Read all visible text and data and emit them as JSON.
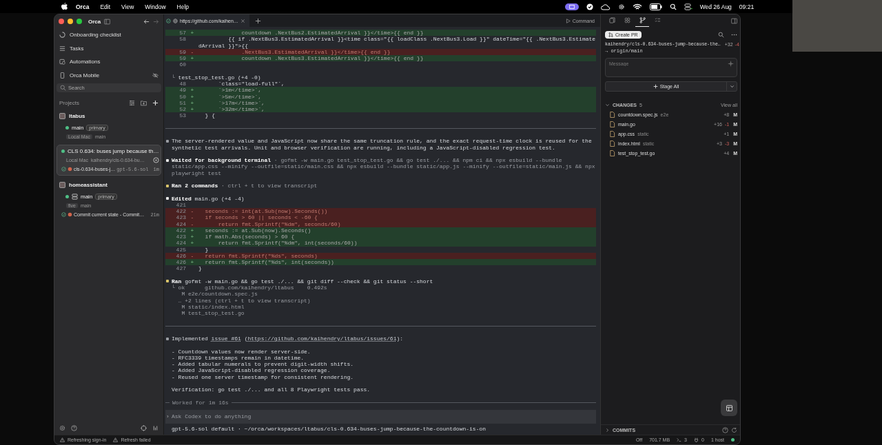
{
  "menubar": {
    "app": "Orca",
    "menus": [
      "Edit",
      "View",
      "Window",
      "Help"
    ],
    "date": "Wed 26 Aug",
    "time": "09:21"
  },
  "sidebar": {
    "title": "Orca",
    "back_disabled": false,
    "forward_disabled": true,
    "nav": [
      {
        "label": "Onboarding checklist"
      },
      {
        "label": "Tasks"
      },
      {
        "label": "Automations"
      },
      {
        "label": "Orca Mobile"
      }
    ],
    "search": {
      "placeholder": "Search"
    },
    "projects_label": "Projects",
    "projects": [
      {
        "name": "ltabus",
        "worktrees": [
          {
            "name": "main",
            "badge": "primary",
            "selected": false,
            "tags": [
              {
                "text": "Local Mac",
                "boxed": true
              },
              {
                "text": "main",
                "boxed": false
              }
            ]
          },
          {
            "name": "CLS 0.634: buses jump because th…",
            "selected": true,
            "tags": [
              {
                "text": "Local Mac",
                "boxed": false
              },
              {
                "text": "kaihendry/cls-0.634-bu…",
                "boxed": false
              }
            ],
            "session": {
              "name": "cls-0.634-buses-j…",
              "model": "gpt-5.6-sol",
              "age": "1m"
            }
          }
        ]
      },
      {
        "name": "homeassistant",
        "worktrees": [
          {
            "name": "main",
            "badge": "primary",
            "selected": false,
            "tags": [
              {
                "text": "five",
                "boxed": true
              },
              {
                "text": "main",
                "boxed": false
              }
            ],
            "session": {
              "name": "Commit current state - Commit…",
              "age": "21m"
            }
          }
        ]
      }
    ]
  },
  "tabs": [
    {
      "label": "https://github.com/kaihen…",
      "selected": true
    }
  ],
  "command_label": "Command",
  "transcript": [
    {
      "kind": "diff",
      "lines": [
        {
          "num": "57",
          "sign": "+",
          "code": "             countdown .NextBus2.EstimatedArrival }}</time>{{ end }}"
        },
        {
          "num": "58",
          "code": "         {{ if .NextBus3.EstimatedArrival }}<time class=\"{{ loadClass .NextBus3.Load }}\" dateTime=\"{{ .NextBus3.EstimatedArrival }}\">{{"
        },
        {
          "num": "59",
          "sign": "-",
          "code": "             .NextBus3.EstimatedArrival }}</time>{{ end }}"
        },
        {
          "num": "59",
          "sign": "+",
          "code": "             countdown .NextBus3.EstimatedArrival }}</time>{{ end }}"
        },
        {
          "num": "60"
        }
      ]
    },
    {
      "kind": "diff",
      "header": {
        "prefix": "└",
        "file": "test_stop_test.go",
        "stats": "(+4 -0)"
      },
      "lines": [
        {
          "num": "48",
          "code": "      `class=\"load-full\"`,"
        },
        {
          "num": "49",
          "sign": "+",
          "code": "      `>1m</time>`,"
        },
        {
          "num": "50",
          "sign": "+",
          "code": "      `>5m</time>`,"
        },
        {
          "num": "51",
          "sign": "+",
          "code": "      `>17m</time>`,"
        },
        {
          "num": "52",
          "sign": "+",
          "code": "      `>32m</time>`,"
        },
        {
          "num": "53",
          "code": "  } {"
        }
      ]
    },
    {
      "kind": "rule"
    },
    {
      "kind": "message",
      "color": "#9a9da3",
      "text": "The server-rendered value and JavaScript now share the same truncation rule, and the exact request-time clock is reused for the synthetic test arrivals. Unit and browser verification are running, including a JavaScript-disabled regression test."
    },
    {
      "kind": "message",
      "color": "#e8e8e8",
      "title": "Waited for background terminal",
      "detail": "· gofmt -w main.go test_stop_test.go && go test ./... && npm ci && npx esbuild --bundle static/app.css --minify --outfile=static/main.css && npx esbuild --bundle static/app.js --minify --outfile=static/main.js && npx playwright test"
    },
    {
      "kind": "message",
      "color": "#d9c46a",
      "title": "Ran 2 commands",
      "detail": "· ctrl + t to view transcript"
    },
    {
      "kind": "diff",
      "header": {
        "color": "#e8e8e8",
        "title": "Edited",
        "file": "main.go",
        "stats": "(+4 -4)"
      },
      "lines": [
        {
          "num": "421"
        },
        {
          "num": "422",
          "sign": "-",
          "code": "  seconds := int(at.Sub(now).Seconds())"
        },
        {
          "num": "423",
          "sign": "-",
          "code": "  if seconds > 60 || seconds < -60 {"
        },
        {
          "num": "424",
          "sign": "-",
          "code": "      return fmt.Sprintf(\"%dm\", seconds/60)"
        },
        {
          "num": "422",
          "sign": "+",
          "code": "  seconds := at.Sub(now).Seconds()"
        },
        {
          "num": "423",
          "sign": "+",
          "code": "  if math.Abs(seconds) > 60 {"
        },
        {
          "num": "424",
          "sign": "+",
          "code": "      return fmt.Sprintf(\"%dm\", int(seconds/60))"
        },
        {
          "num": "425",
          "code": "  }"
        },
        {
          "num": "426",
          "sign": "-",
          "code": "  return fmt.Sprintf(\"%ds\", seconds)"
        },
        {
          "num": "426",
          "sign": "+",
          "code": "  return fmt.Sprintf(\"%ds\", int(seconds))"
        },
        {
          "num": "427",
          "code": "}"
        }
      ]
    },
    {
      "kind": "message",
      "color": "#d9c46a",
      "title": "Ran",
      "command": "gofmt -w main.go && go test ./... && git diff --check && git status --short",
      "lines": [
        "└ ok      github.com/kaihendry/ltabus    0.492s",
        "   M e2e/countdown.spec.js",
        "  … +2 lines (ctrl + t to view transcript)",
        "   M static/index.html",
        "   M test_stop_test.go"
      ]
    },
    {
      "kind": "rule"
    },
    {
      "kind": "message",
      "color": "#9a9da3",
      "segments": [
        {
          "text": "Implemented "
        },
        {
          "text": "issue #61",
          "link": true
        },
        {
          "text": " ("
        },
        {
          "text": "https://github.com/kaihendry/ltabus/issues/61",
          "link": true
        },
        {
          "text": "):"
        }
      ]
    },
    {
      "kind": "list",
      "items": [
        [
          {
            "text": "- Countdown values now render server-side."
          }
        ],
        [
          {
            "text": "- RFC3339 timestamps remain in datetime."
          }
        ],
        [
          {
            "text": "- Added tabular numerals to prevent digit-width shifts."
          }
        ],
        [
          {
            "text": "- Added JavaScript-disabled regression coverage."
          }
        ],
        [
          {
            "text": "- Reused one server timestamp for consistent rendering."
          }
        ]
      ]
    },
    {
      "kind": "message",
      "text": "Verification: go test ./... and all 8 Playwright tests pass."
    },
    {
      "kind": "worked",
      "text": "Worked for 1m 16s"
    }
  ],
  "composer": {
    "prompt": "›",
    "placeholder": "Ask Codex to do anything"
  },
  "footer": "gpt-5.6-sol default · ~/orca/workspaces/ltabus/cls-0.634-buses-jump-because-the-countdown-is-on",
  "panel": {
    "tabs": [
      {
        "selected": false
      },
      {
        "selected": false
      },
      {
        "selected": true
      },
      {
        "selected": false
      }
    ],
    "create_pr": "Create PR",
    "branch": "kaihendry/cls-0.634-buses-jump-because-the…",
    "added": "+32",
    "removed": "-4",
    "upstream": "→ origin/main",
    "message": {
      "placeholder": "Message"
    },
    "stage_all": "Stage All",
    "changes": {
      "title": "CHANGES",
      "count": "5",
      "expanded": true,
      "view_all": "View all",
      "files": [
        {
          "name": "countdown.spec.js",
          "dir": "e2e",
          "added": "+8",
          "status": "M"
        },
        {
          "name": "main.go",
          "added": "+16",
          "removed": "-1",
          "status": "M"
        },
        {
          "name": "app.css",
          "dir": "static",
          "added": "+1",
          "status": "M"
        },
        {
          "name": "index.html",
          "dir": "static",
          "added": "+3",
          "removed": "-3",
          "status": "M"
        },
        {
          "name": "test_stop_test.go",
          "added": "+4",
          "status": "M"
        }
      ]
    },
    "commits": {
      "title": "COMMITS",
      "expanded": false
    }
  },
  "status_bar": {
    "left": [
      "Refreshing sign-in",
      "Refresh failed"
    ],
    "off": "Off",
    "memory": "701.7 MB",
    "terminals": "3",
    "ports": "0",
    "hosts": "1 host"
  }
}
